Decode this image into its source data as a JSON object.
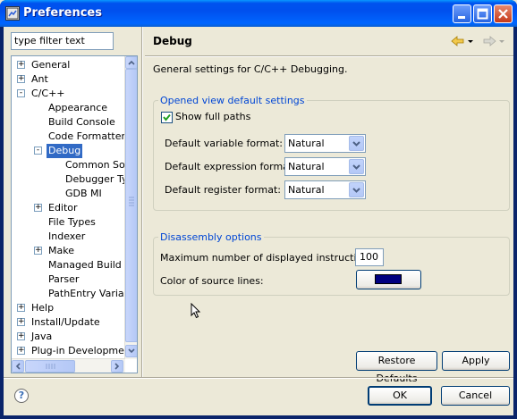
{
  "window": {
    "title": "Preferences"
  },
  "filter": {
    "text": "type filter text"
  },
  "tree": [
    {
      "label": "General",
      "level": 0,
      "expander": "+"
    },
    {
      "label": "Ant",
      "level": 0,
      "expander": "+"
    },
    {
      "label": "C/C++",
      "level": 0,
      "expander": "-"
    },
    {
      "label": "Appearance",
      "level": 1,
      "expander": ""
    },
    {
      "label": "Build Console",
      "level": 1,
      "expander": ""
    },
    {
      "label": "Code Formatter",
      "level": 1,
      "expander": ""
    },
    {
      "label": "Debug",
      "level": 1,
      "expander": "-",
      "selected": true
    },
    {
      "label": "Common Sour",
      "level": 2,
      "expander": ""
    },
    {
      "label": "Debugger Typ",
      "level": 2,
      "expander": ""
    },
    {
      "label": "GDB MI",
      "level": 2,
      "expander": ""
    },
    {
      "label": "Editor",
      "level": 1,
      "expander": "+"
    },
    {
      "label": "File Types",
      "level": 1,
      "expander": ""
    },
    {
      "label": "Indexer",
      "level": 1,
      "expander": ""
    },
    {
      "label": "Make",
      "level": 1,
      "expander": "+"
    },
    {
      "label": "Managed Build",
      "level": 1,
      "expander": ""
    },
    {
      "label": "Parser",
      "level": 1,
      "expander": ""
    },
    {
      "label": "PathEntry Variabl",
      "level": 1,
      "expander": ""
    },
    {
      "label": "Help",
      "level": 0,
      "expander": "+"
    },
    {
      "label": "Install/Update",
      "level": 0,
      "expander": "+"
    },
    {
      "label": "Java",
      "level": 0,
      "expander": "+"
    },
    {
      "label": "Plug-in Development",
      "level": 0,
      "expander": "+"
    }
  ],
  "page": {
    "title": "Debug",
    "description": "General settings for C/C++ Debugging."
  },
  "view_settings": {
    "group_title": "Opened view default settings",
    "show_full_paths_label": "Show full paths",
    "show_full_paths_checked": true,
    "variable_format_label": "Default variable format:",
    "variable_format_value": "Natural",
    "expression_format_label": "Default expression format:",
    "expression_format_value": "Natural",
    "register_format_label": "Default register format:",
    "register_format_value": "Natural"
  },
  "disassembly": {
    "group_title": "Disassembly options",
    "max_instructions_label": "Maximum number of displayed instructions:",
    "max_instructions_value": "100",
    "color_label": "Color of source lines:",
    "color_value": "#000080"
  },
  "buttons": {
    "restore_defaults": "Restore Defaults",
    "apply": "Apply",
    "ok": "OK",
    "cancel": "Cancel"
  },
  "icons": {
    "help": "?",
    "back": "back-arrow-icon",
    "forward": "forward-arrow-icon"
  }
}
